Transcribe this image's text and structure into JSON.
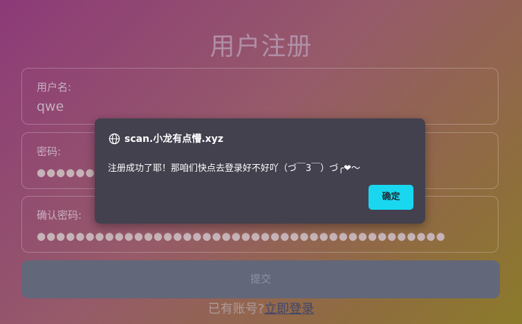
{
  "page": {
    "title": "用户注册"
  },
  "form": {
    "username": {
      "label": "用户名:",
      "value": "qwe"
    },
    "password": {
      "label": "密码:",
      "value": "●●●●●●"
    },
    "confirm_password": {
      "label": "确认密码:",
      "value": "●●●●●●●●●●●●●●●●●●●●●●●●●●●●●●●●●●●●●●●●●●"
    },
    "submit_label": "提交"
  },
  "footer": {
    "prompt": "已有账号?",
    "login_link": "立即登录"
  },
  "dialog": {
    "origin": "scan.小龙有点懵.xyz",
    "message": "注册成功了耶！那咱们快点去登录好不好吖（づ￣3￣）づ╭❤～",
    "ok_label": "确定"
  },
  "colors": {
    "accent": "#1ad7f0",
    "dialog_bg": "#43414e"
  },
  "icons": {
    "origin": "globe-icon"
  }
}
